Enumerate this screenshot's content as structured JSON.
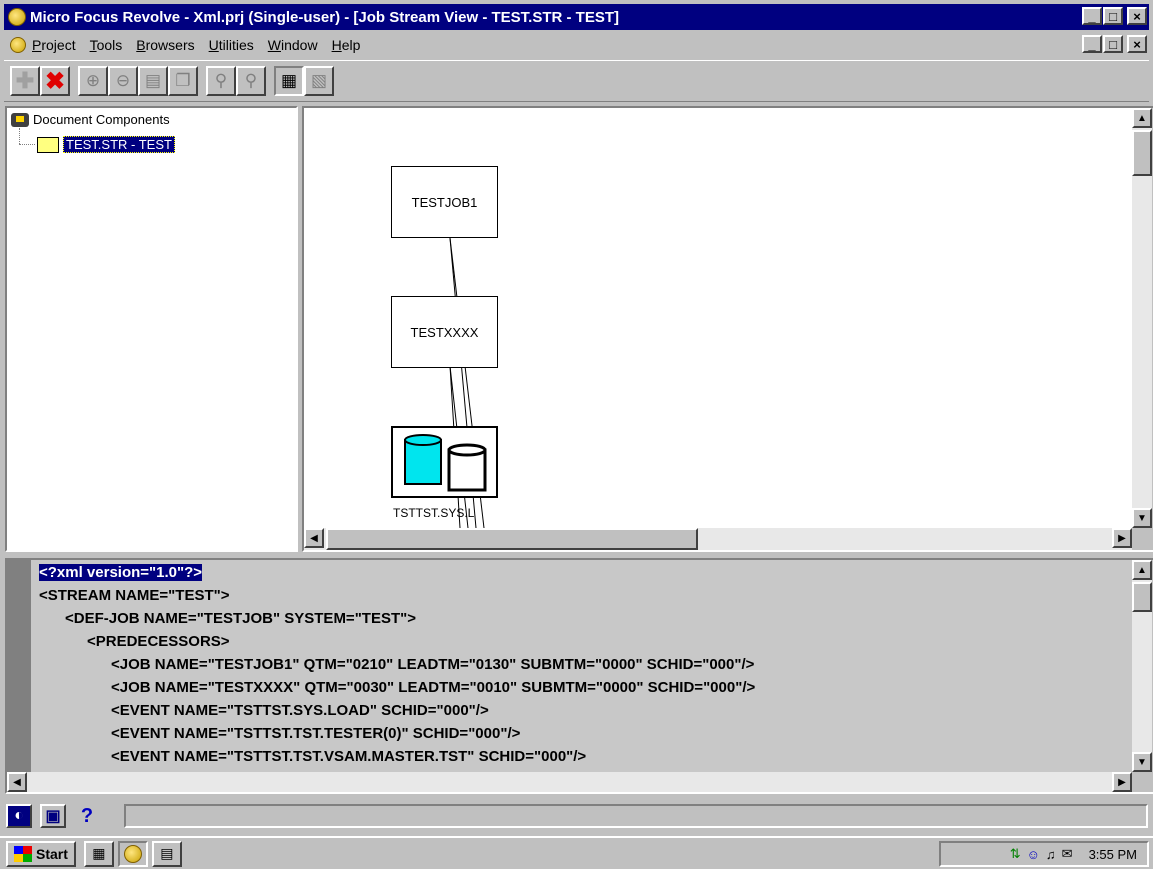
{
  "window": {
    "title": "Micro Focus Revolve - Xml.prj (Single-user) - [Job Stream View - TEST.STR - TEST]",
    "controls": [
      "_",
      "□",
      "×"
    ]
  },
  "menubar": {
    "items": [
      "Project",
      "Tools",
      "Browsers",
      "Utilities",
      "Window",
      "Help"
    ]
  },
  "toolbar": {
    "icons": [
      "add-icon",
      "delete-icon",
      "zoom-in-icon",
      "zoom-out-icon",
      "save-icon",
      "copy-icon",
      "find-icon",
      "find-next-icon",
      "grid-view-icon",
      "list-view-icon"
    ]
  },
  "tree": {
    "root_label": "Document Components",
    "child_label": "TEST.STR - TEST"
  },
  "diagram": {
    "nodes": [
      {
        "label": "TESTJOB1"
      },
      {
        "label": "TESTXXXX"
      },
      {
        "label": "TSTTST.SYS.L"
      }
    ]
  },
  "xml": {
    "lines": [
      "<?xml version=\"1.0\"?>",
      "<STREAM NAME=\"TEST\">",
      "<DEF-JOB NAME=\"TESTJOB\" SYSTEM=\"TEST\">",
      "<PREDECESSORS>",
      "<JOB NAME=\"TESTJOB1\" QTM=\"0210\" LEADTM=\"0130\" SUBMTM=\"0000\" SCHID=\"000\"/>",
      "<JOB NAME=\"TESTXXXX\" QTM=\"0030\" LEADTM=\"0010\" SUBMTM=\"0000\" SCHID=\"000\"/>",
      "<EVENT NAME=\"TSTTST.SYS.LOAD\" SCHID=\"000\"/>",
      "<EVENT NAME=\"TSTTST.TST.TESTER(0)\" SCHID=\"000\"/>",
      "<EVENT NAME=\"TSTTST.TST.VSAM.MASTER.TST\" SCHID=\"000\"/>"
    ]
  },
  "statusbar": {
    "help_label": "?"
  },
  "taskbar": {
    "start_label": "Start",
    "clock": "3:55 PM"
  }
}
